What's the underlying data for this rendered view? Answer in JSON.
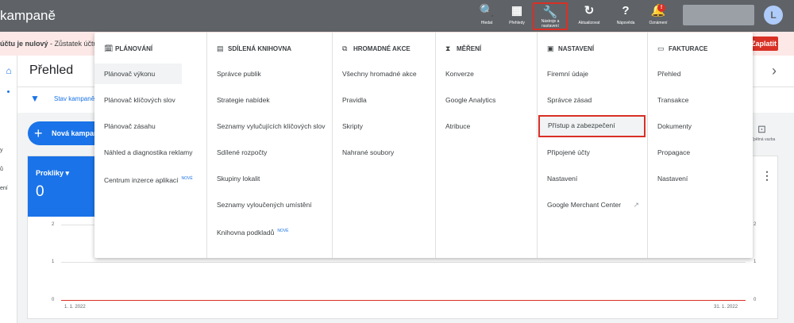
{
  "header": {
    "title": "kampaně",
    "buttons": [
      {
        "name": "search",
        "icon": "🔍",
        "label": "Hledat"
      },
      {
        "name": "reports",
        "icon": "▦",
        "label": "Přehledy"
      },
      {
        "name": "tools",
        "icon": "🔧",
        "label": "Nástroje a nastavení"
      },
      {
        "name": "refresh",
        "icon": "↻",
        "label": "Aktualizovat"
      },
      {
        "name": "help",
        "icon": "?",
        "label": "Nápověda"
      },
      {
        "name": "notifications",
        "icon": "🔔",
        "label": "Oznámení",
        "badge": "!"
      }
    ],
    "avatar_letter": "L"
  },
  "notice": {
    "bold": "účtu je nulový",
    "text": " - Zůstatek účtu je bi",
    "button": "Zaplatit"
  },
  "leftrail": {
    "labels": [
      "y",
      "ů",
      "ení"
    ]
  },
  "main": {
    "title": "Přehled",
    "filter_text": "Stav kampaně",
    "new_campaign": "Nová kampaň",
    "feedback": "Zpětná vazba",
    "metric_label": "Prokliky",
    "metric_value": "0",
    "y_ticks_left": [
      "2",
      "1",
      "0"
    ],
    "y_ticks_right": [
      "2",
      "1",
      "0"
    ],
    "x_start": "1. 1. 2022",
    "x_end": "31. 1. 2022"
  },
  "menu": {
    "columns": [
      {
        "heading": "PLÁNOVÁNÍ",
        "icon": "🗓",
        "items": [
          "Plánovač výkonu",
          "Plánovač klíčových slov",
          "Plánovač zásahu",
          "Náhled a diagnostika reklamy",
          "Centrum inzerce aplikací"
        ],
        "new_badge": "NOVÉ"
      },
      {
        "heading": "SDÍLENÁ KNIHOVNA",
        "icon": "▤",
        "items": [
          "Správce publik",
          "Strategie nabídek",
          "Seznamy vylučujících klíčových slov",
          "Sdílené rozpočty",
          "Skupiny lokalit",
          "Seznamy vyloučených umístění",
          "Knihovna podkladů"
        ],
        "new_badge": "NOVÉ"
      },
      {
        "heading": "HROMADNÉ AKCE",
        "icon": "⧉",
        "items": [
          "Všechny hromadné akce",
          "Pravidla",
          "Skripty",
          "Nahrané soubory"
        ]
      },
      {
        "heading": "MĚŘENÍ",
        "icon": "⧗",
        "items": [
          "Konverze",
          "Google Analytics",
          "Atribuce"
        ]
      },
      {
        "heading": "NASTAVENÍ",
        "icon": "▣",
        "items": [
          "Firemní údaje",
          "Správce zásad",
          "Přístup a zabezpečení",
          "Připojené účty",
          "Nastavení",
          "Google Merchant Center"
        ]
      },
      {
        "heading": "FAKTURACE",
        "icon": "▭",
        "items": [
          "Přehled",
          "Transakce",
          "Dokumenty",
          "Propagace",
          "Nastavení"
        ]
      }
    ]
  },
  "colors": {
    "topbar": "#5f6368",
    "accent": "#1a73e8",
    "highlight": "#d93025"
  }
}
